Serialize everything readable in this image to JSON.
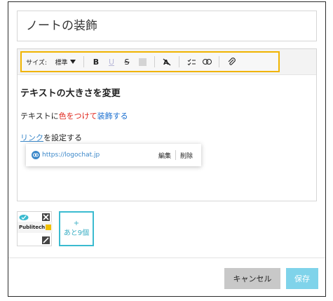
{
  "title": "ノートの装飾",
  "toolbar": {
    "size_label": "サイズ:",
    "size_value": "標準",
    "bold": "B",
    "underline": "U",
    "strike": "S",
    "icons": [
      "color-swatch-icon",
      "clear-format-icon",
      "checklist-icon",
      "link-icon",
      "attachment-icon"
    ],
    "highlight_color": "#f0b400"
  },
  "content": {
    "heading": "テキストの大きさを変更",
    "line2_part1": "テキストに",
    "line2_red": "色をつけて",
    "line2_blue": "装飾する",
    "line3_link": "リンク",
    "line3_rest": "を設定する"
  },
  "link_popup": {
    "url": "https://logochat.jp",
    "edit": "編集",
    "delete": "削除"
  },
  "attachments": {
    "thumb_text": "Publitech",
    "more_plus": "+",
    "more_label": "あと9個"
  },
  "buttons": {
    "cancel": "キャンセル",
    "save": "保存"
  },
  "colors": {
    "red_text": "#e0261c",
    "blue_text": "#1a6fd0",
    "save_bg": "#7fd3ea",
    "accent": "#3bbbd0"
  }
}
